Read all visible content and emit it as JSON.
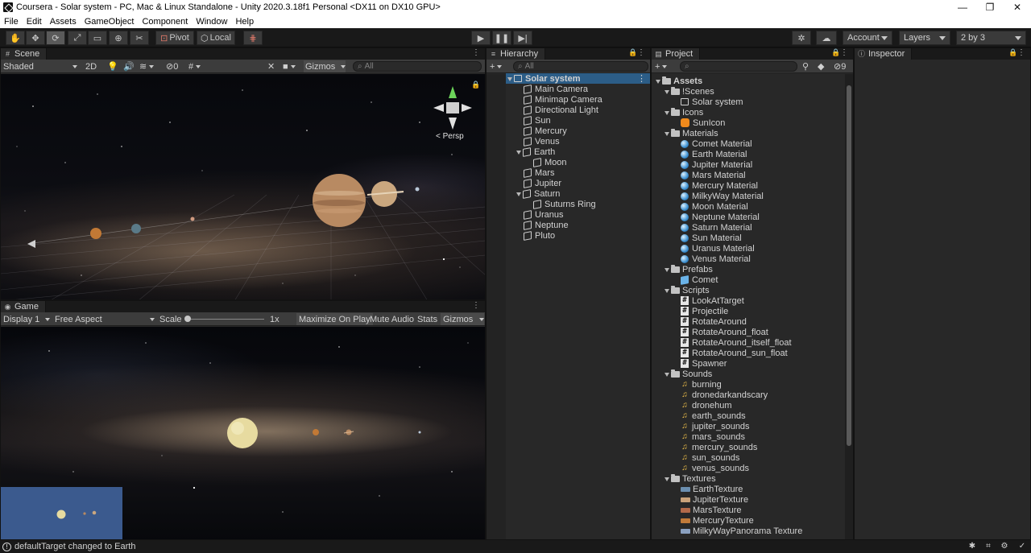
{
  "window": {
    "title": "Coursera - Solar system - PC, Mac & Linux Standalone - Unity 2020.3.18f1 Personal <DX11 on DX10 GPU>",
    "buttons": {
      "minimize": "—",
      "maximize": "❐",
      "close": "✕"
    }
  },
  "menu": [
    "File",
    "Edit",
    "Assets",
    "GameObject",
    "Component",
    "Window",
    "Help"
  ],
  "toolbar": {
    "pivot_label": "Pivot",
    "local_label": "Local",
    "account_label": "Account",
    "layers_label": "Layers",
    "layout_label": "2 by 3",
    "tools": [
      "hand-tool-icon",
      "move-tool-icon",
      "rotate-tool-icon",
      "scale-tool-icon",
      "rect-tool-icon",
      "transform-tool-icon",
      "custom-tool-icon"
    ],
    "play_controls": [
      "play-icon",
      "pause-icon",
      "step-icon"
    ]
  },
  "scene": {
    "tab_label": "Scene",
    "shading_mode": "Shaded",
    "mode_2d_label": "2D",
    "hidden_count": "0",
    "gizmos_label": "Gizmos",
    "search_placeholder": "All",
    "projection_label": "< Persp"
  },
  "game": {
    "tab_label": "Game",
    "display_label": "Display 1",
    "aspect_label": "Free Aspect",
    "scale_label": "Scale",
    "scale_value": "1x",
    "maximize_label": "Maximize On Play",
    "mute_label": "Mute Audio",
    "stats_label": "Stats",
    "gizmos_label": "Gizmos"
  },
  "hierarchy": {
    "tab_label": "Hierarchy",
    "search_placeholder": "All",
    "scene_name": "Solar system",
    "items": [
      {
        "label": "Main Camera",
        "depth": 0
      },
      {
        "label": "Minimap Camera",
        "depth": 0
      },
      {
        "label": "Directional Light",
        "depth": 0
      },
      {
        "label": "Sun",
        "depth": 0
      },
      {
        "label": "Mercury",
        "depth": 0
      },
      {
        "label": "Venus",
        "depth": 0
      },
      {
        "label": "Earth",
        "depth": 0,
        "expanded": true
      },
      {
        "label": "Moon",
        "depth": 1
      },
      {
        "label": "Mars",
        "depth": 0
      },
      {
        "label": "Jupiter",
        "depth": 0
      },
      {
        "label": "Saturn",
        "depth": 0,
        "expanded": true
      },
      {
        "label": "Suturns Ring",
        "depth": 1
      },
      {
        "label": "Uranus",
        "depth": 0
      },
      {
        "label": "Neptune",
        "depth": 0
      },
      {
        "label": "Pluto",
        "depth": 0
      }
    ]
  },
  "project": {
    "tab_label": "Project",
    "hidden_packages_count": "9",
    "tree": [
      {
        "label": "Assets",
        "type": "root"
      },
      {
        "label": "!Scenes",
        "type": "folder"
      },
      {
        "label": "Solar system",
        "type": "scene"
      },
      {
        "label": "Icons",
        "type": "folder"
      },
      {
        "label": "SunIcon",
        "type": "icon"
      },
      {
        "label": "Materials",
        "type": "folder"
      },
      {
        "label": "Comet Material",
        "type": "material"
      },
      {
        "label": "Earth Material",
        "type": "material"
      },
      {
        "label": "Jupiter Material",
        "type": "material"
      },
      {
        "label": "Mars Material",
        "type": "material"
      },
      {
        "label": "Mercury Material",
        "type": "material"
      },
      {
        "label": "MilkyWay Material",
        "type": "material"
      },
      {
        "label": "Moon Material",
        "type": "material"
      },
      {
        "label": "Neptune Material",
        "type": "material"
      },
      {
        "label": "Saturn Material",
        "type": "material"
      },
      {
        "label": "Sun Material",
        "type": "material"
      },
      {
        "label": "Uranus Material",
        "type": "material"
      },
      {
        "label": "Venus Material",
        "type": "material"
      },
      {
        "label": "Prefabs",
        "type": "folder"
      },
      {
        "label": "Comet",
        "type": "prefab"
      },
      {
        "label": "Scripts",
        "type": "folder"
      },
      {
        "label": "LookAtTarget",
        "type": "script"
      },
      {
        "label": "Projectile",
        "type": "script"
      },
      {
        "label": "RotateAround",
        "type": "script"
      },
      {
        "label": "RotateAround_float",
        "type": "script"
      },
      {
        "label": "RotateAround_itself_float",
        "type": "script"
      },
      {
        "label": "RotateAround_sun_float",
        "type": "script"
      },
      {
        "label": "Spawner",
        "type": "script"
      },
      {
        "label": "Sounds",
        "type": "folder"
      },
      {
        "label": "burning",
        "type": "audio"
      },
      {
        "label": "dronedarkandscary",
        "type": "audio"
      },
      {
        "label": "dronehum",
        "type": "audio"
      },
      {
        "label": "earth_sounds",
        "type": "audio"
      },
      {
        "label": "jupiter_sounds",
        "type": "audio"
      },
      {
        "label": "mars_sounds",
        "type": "audio"
      },
      {
        "label": "mercury_sounds",
        "type": "audio"
      },
      {
        "label": "sun_sounds",
        "type": "audio"
      },
      {
        "label": "venus_sounds",
        "type": "audio"
      },
      {
        "label": "Textures",
        "type": "folder"
      },
      {
        "label": "EarthTexture",
        "type": "texture",
        "color": "#6b8fb0"
      },
      {
        "label": "JupiterTexture",
        "type": "texture",
        "color": "#c9a27a"
      },
      {
        "label": "MarsTexture",
        "type": "texture",
        "color": "#b26a4a"
      },
      {
        "label": "MercuryTexture",
        "type": "texture",
        "color": "#c07a3a"
      },
      {
        "label": "MilkyWayPanorama Texture",
        "type": "texture",
        "color": "#8aa0c0"
      }
    ]
  },
  "inspector": {
    "tab_label": "Inspector"
  },
  "status": {
    "message": "defaultTarget changed to Earth"
  },
  "colors": {
    "selection": "#2c5d87",
    "panel_bg": "#282828",
    "toolbar_bg": "#191919",
    "minimap_bg": "#3b5a8e"
  }
}
